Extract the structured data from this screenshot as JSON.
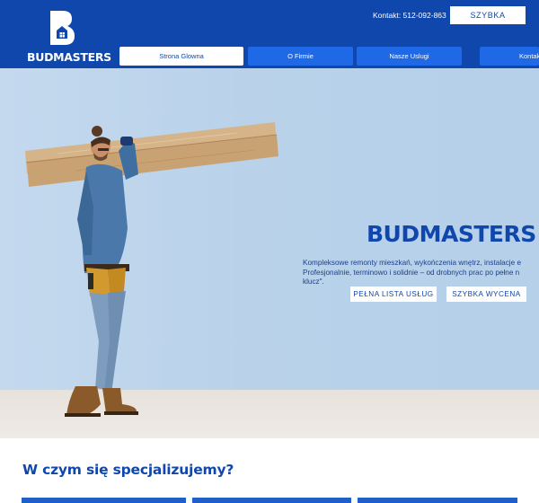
{
  "header": {
    "logo_text": "BUDMASTERS",
    "contact": "Kontakt: 512-092-863",
    "quote_button": "SZYBKA WYCENA"
  },
  "nav": {
    "items": [
      {
        "label": "Strona Glowna",
        "active": true
      },
      {
        "label": "O Firmie"
      },
      {
        "label": "Nasze Uslugi"
      },
      {
        "label": "Kontakt"
      }
    ]
  },
  "hero": {
    "title": "BUDMASTERS",
    "description": "Kompleksowe remonty mieszkań, wykończenia wnętrz, instalacje e\nProfesjonalnie, terminowo i solidnie – od drobnych prac po pełne n\nklucz\".",
    "buttons": [
      "PEŁNA LISTA USŁUG",
      "SZYBKA WYCENA"
    ]
  },
  "section": {
    "title": "W czym się specjalizujemy?"
  },
  "colors": {
    "brand": "#0f47ad",
    "nav_button": "#1f68e6",
    "hero_bg": "#b9d2ea"
  }
}
